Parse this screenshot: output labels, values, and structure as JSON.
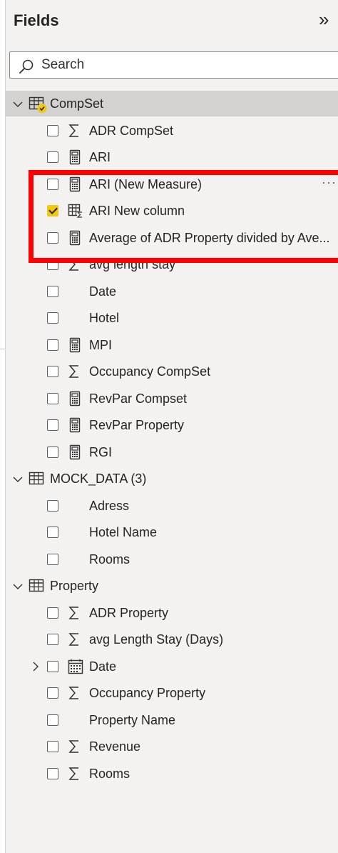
{
  "pane": {
    "title": "Fields"
  },
  "search": {
    "placeholder": "Search",
    "value": ""
  },
  "tables": [
    {
      "name": "CompSet",
      "expanded": true,
      "fields": [
        {
          "label": "ADR CompSet",
          "icon": "sigma-icon",
          "checked": false
        },
        {
          "label": "ARI",
          "icon": "calculator-icon",
          "checked": false
        },
        {
          "label": "ARI (New Measure)",
          "icon": "calculator-icon",
          "checked": false,
          "more": "···"
        },
        {
          "label": "ARI New column",
          "icon": "calculated-column-icon",
          "checked": true
        },
        {
          "label": "Average of ADR Property divided by Ave...",
          "icon": "calculator-icon",
          "checked": false
        },
        {
          "label": "avg length stay",
          "icon": "sigma-icon",
          "checked": false
        },
        {
          "label": "Date",
          "icon": "",
          "checked": false
        },
        {
          "label": "Hotel",
          "icon": "",
          "checked": false
        },
        {
          "label": "MPI",
          "icon": "calculator-icon",
          "checked": false
        },
        {
          "label": "Occupancy CompSet",
          "icon": "sigma-icon",
          "checked": false
        },
        {
          "label": "RevPar Compset",
          "icon": "calculator-icon",
          "checked": false
        },
        {
          "label": "RevPar Property",
          "icon": "calculator-icon",
          "checked": false
        },
        {
          "label": "RGI",
          "icon": "calculator-icon",
          "checked": false
        }
      ]
    },
    {
      "name": "MOCK_DATA (3)",
      "expanded": true,
      "fields": [
        {
          "label": "Adress",
          "icon": "",
          "checked": false
        },
        {
          "label": "Hotel Name",
          "icon": "",
          "checked": false
        },
        {
          "label": "Rooms",
          "icon": "",
          "checked": false
        }
      ]
    },
    {
      "name": "Property",
      "expanded": true,
      "fields": [
        {
          "label": "ADR Property",
          "icon": "sigma-icon",
          "checked": false
        },
        {
          "label": "avg Length Stay (Days)",
          "icon": "sigma-icon",
          "checked": false
        },
        {
          "label": "Date",
          "icon": "calendar-icon",
          "checked": false,
          "expandable": true
        },
        {
          "label": "Occupancy Property",
          "icon": "sigma-icon",
          "checked": false
        },
        {
          "label": "Property Name",
          "icon": "",
          "checked": false
        },
        {
          "label": "Revenue",
          "icon": "sigma-icon",
          "checked": false
        },
        {
          "label": "Rooms",
          "icon": "sigma-icon",
          "checked": false
        }
      ]
    }
  ],
  "colors": {
    "highlight_box": "#ff0000",
    "checkbox_checked": "#f2c811",
    "selected_row": "#d4d2d0"
  }
}
